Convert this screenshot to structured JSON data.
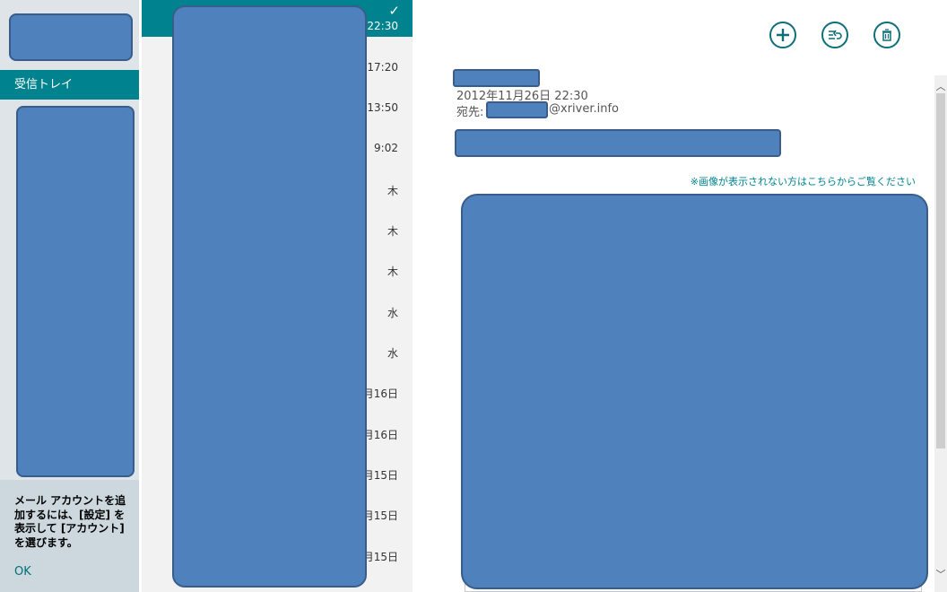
{
  "sidebar": {
    "inbox_label": "受信トレイ",
    "hint_text": "メール アカウントを追\n加するには、[設定] を\n表示して [アカウント]\nを選びます。",
    "ok_label": "OK"
  },
  "message_list": {
    "selected_check": "✓",
    "items": [
      {
        "time": "22:30",
        "selected": true
      },
      {
        "time": "17:20"
      },
      {
        "time": "13:50"
      },
      {
        "time": "9:02"
      },
      {
        "time": "木"
      },
      {
        "time": "木"
      },
      {
        "time": "木"
      },
      {
        "time": "水"
      },
      {
        "time": "水"
      },
      {
        "time": "月16日"
      },
      {
        "time": "月16日"
      },
      {
        "time": "月15日"
      },
      {
        "time": "月15日"
      },
      {
        "time": "月15日"
      }
    ]
  },
  "reading_pane": {
    "date": "2012年11月26日  22:30",
    "to_label": "宛先:",
    "to_domain": "@xriver.info",
    "image_notice": "※画像が表示されない方はこちらからご覧ください"
  },
  "commands": {
    "new_icon": "plus-icon",
    "reply_icon": "reply-icon",
    "delete_icon": "trash-icon"
  },
  "colors": {
    "accent": "#00838f",
    "redaction": "#4f81bd"
  }
}
